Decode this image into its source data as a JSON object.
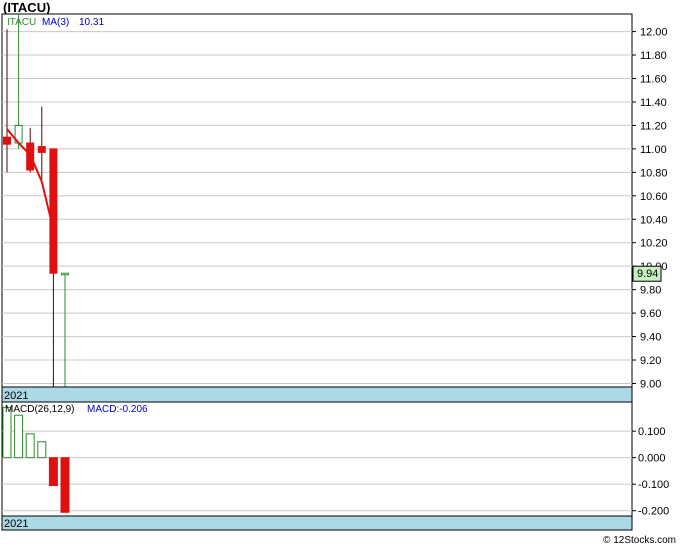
{
  "title": "(ITACU)",
  "footer": "© 12Stocks.com",
  "colors": {
    "grid": "#c8c8c8",
    "up_candle": "#2e8b2e",
    "down_candle": "#e01010",
    "ma_line": "#e01010",
    "year_band": "#add8e6",
    "price_tag_bg": "#c8f0c0",
    "macd_up": "#2e8b2e",
    "macd_down": "#e01010",
    "legend_blue": "#0000cc"
  },
  "chart_data": [
    {
      "type": "candlestick",
      "panel": "price",
      "ticker_label": "ITACU",
      "ma_label": "MA(3)",
      "ma_value_label": "10.31",
      "year_label": "2021",
      "ylim": [
        8.97,
        12.15
      ],
      "yticks": [
        "12.00",
        "11.80",
        "11.60",
        "11.40",
        "11.20",
        "11.00",
        "10.80",
        "10.60",
        "10.40",
        "10.20",
        "10.00",
        "9.80",
        "9.60",
        "9.40",
        "9.20",
        "9.00"
      ],
      "last_price_label": "9.94",
      "last_price": 9.94,
      "candles": [
        {
          "open": 11.1,
          "high": 12.02,
          "low": 10.8,
          "close": 11.04
        },
        {
          "open": 11.05,
          "high": 12.15,
          "low": 11.0,
          "close": 11.2
        },
        {
          "open": 11.05,
          "high": 11.18,
          "low": 10.8,
          "close": 10.82
        },
        {
          "open": 11.02,
          "high": 11.36,
          "low": 10.74,
          "close": 10.97
        },
        {
          "open": 11.0,
          "high": 11.0,
          "low": 8.97,
          "close": 9.94
        },
        {
          "open": 9.94,
          "high": 9.94,
          "low": 8.97,
          "close": 9.94
        }
      ],
      "ma_points": [
        11.17,
        11.05,
        10.95,
        10.72,
        10.31
      ]
    },
    {
      "type": "bar",
      "panel": "macd",
      "label": "MACD(26,12,9)",
      "value_label": "MACD:-0.206",
      "year_label": "2021",
      "ylim": [
        -0.22,
        0.21
      ],
      "yticks": [
        "0.100",
        "0.000",
        "-0.100",
        "-0.200"
      ],
      "values": [
        0.19,
        0.16,
        0.09,
        0.06,
        -0.105,
        -0.206
      ]
    }
  ]
}
